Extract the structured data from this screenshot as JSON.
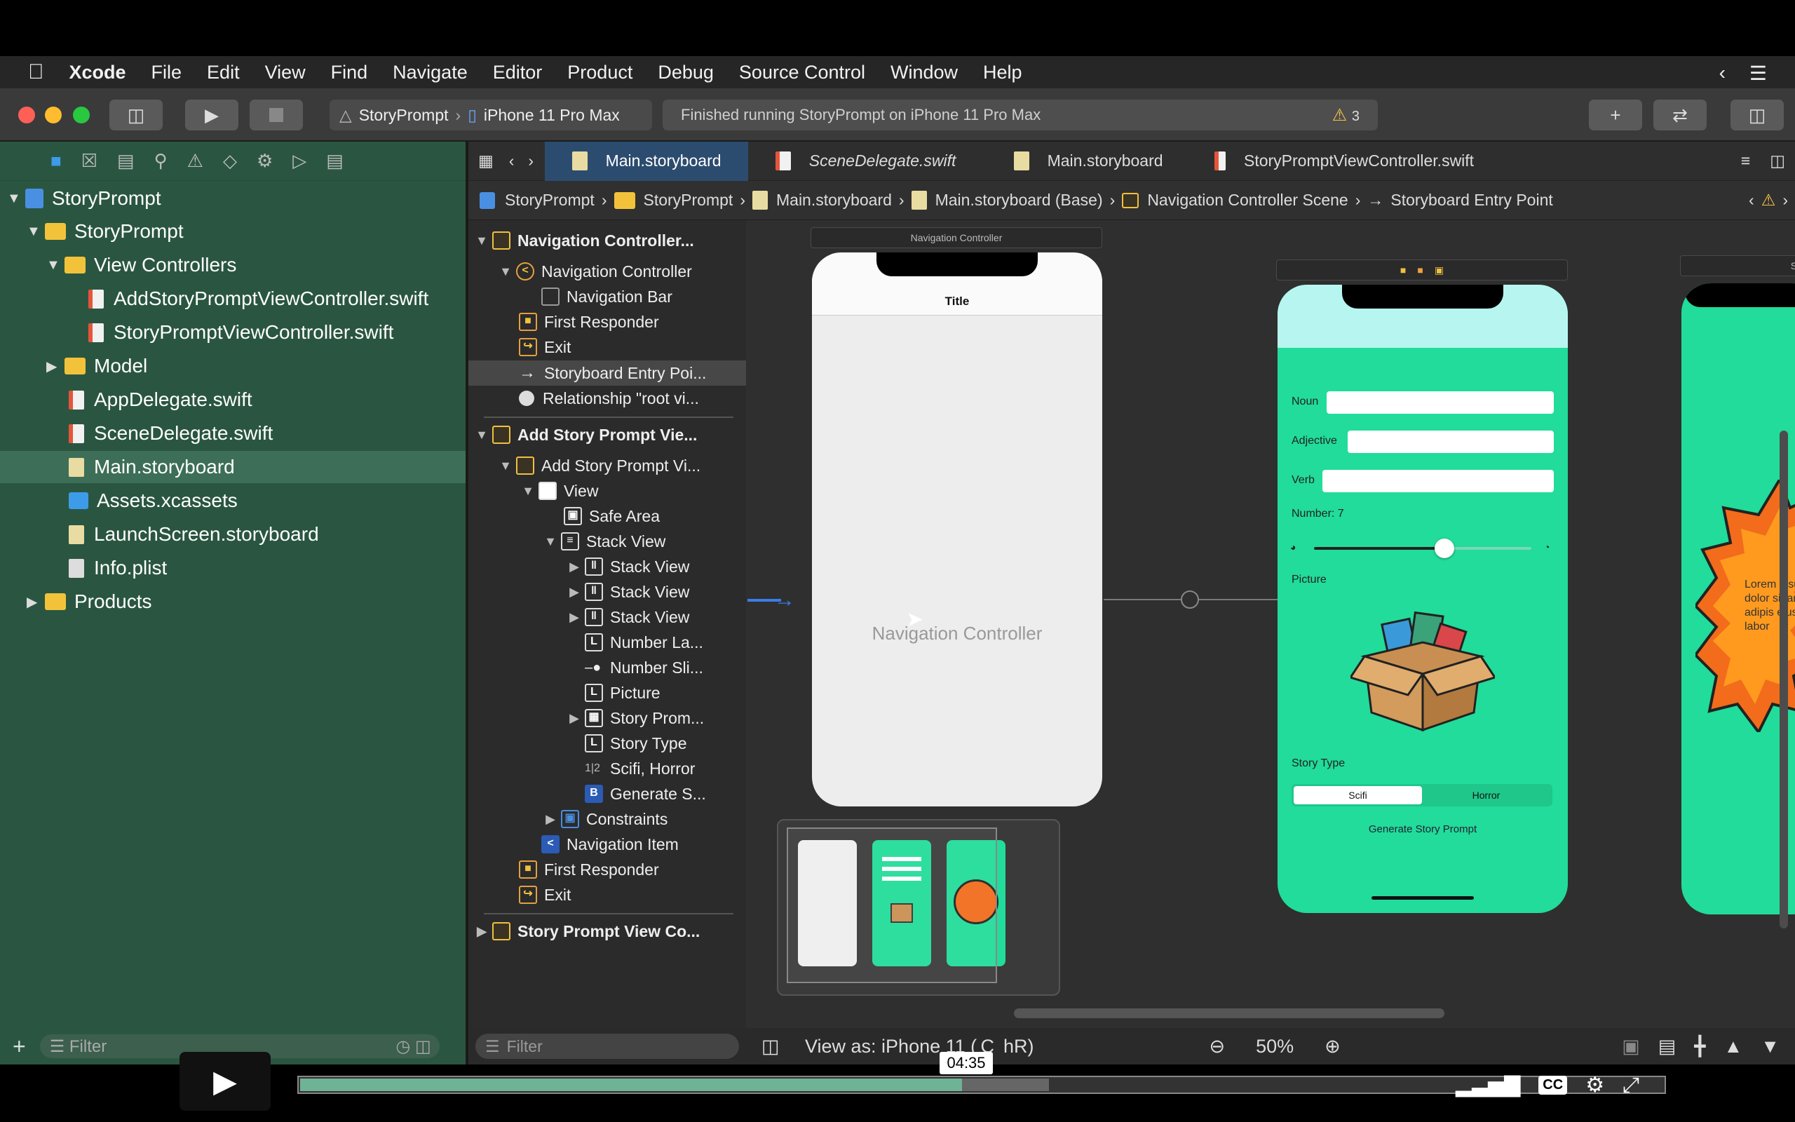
{
  "menubar": {
    "apple": "",
    "app": "Xcode",
    "items": [
      "File",
      "Edit",
      "View",
      "Find",
      "Navigate",
      "Editor",
      "Product",
      "Debug",
      "Source Control",
      "Window",
      "Help"
    ]
  },
  "toolbar": {
    "scheme": "StoryPrompt",
    "device": "iPhone 11 Pro Max",
    "status": "Finished running StoryPrompt on iPhone 11 Pro Max",
    "warnings": "3"
  },
  "navigator": {
    "project": "StoryPrompt",
    "group": "StoryPrompt",
    "vc_group": "View Controllers",
    "files": {
      "add_vc": "AddStoryPromptViewController.swift",
      "story_vc": "StoryPromptViewController.swift",
      "model": "Model",
      "app_delegate": "AppDelegate.swift",
      "scene_delegate": "SceneDelegate.swift",
      "main_sb": "Main.storyboard",
      "assets": "Assets.xcassets",
      "launch": "LaunchScreen.storyboard",
      "info": "Info.plist",
      "products": "Products"
    },
    "filter_placeholder": "Filter"
  },
  "tabs": [
    {
      "label": "Main.storyboard",
      "active": true
    },
    {
      "label": "SceneDelegate.swift",
      "active": false
    },
    {
      "label": "Main.storyboard",
      "active": false
    },
    {
      "label": "StoryPromptViewController.swift",
      "active": false
    }
  ],
  "jumpbar": [
    "StoryPrompt",
    "StoryPrompt",
    "Main.storyboard",
    "Main.storyboard (Base)",
    "Navigation Controller Scene",
    "Storyboard Entry Point"
  ],
  "outline": {
    "nav_scene": "Navigation Controller...",
    "nav_controller": "Navigation Controller",
    "nav_bar": "Navigation Bar",
    "first_responder": "First Responder",
    "exit": "Exit",
    "entry_point": "Storyboard Entry Poi...",
    "relationship": "Relationship \"root vi...",
    "add_scene": "Add Story Prompt Vie...",
    "add_vc": "Add Story Prompt Vi...",
    "view": "View",
    "safe_area": "Safe Area",
    "stack_view": "Stack View",
    "stack1": "Stack View",
    "stack2": "Stack View",
    "stack3": "Stack View",
    "number_label": "Number La...",
    "number_slider": "Number Sli...",
    "picture": "Picture",
    "story_prompt_image": "Story Prom...",
    "story_type": "Story Type",
    "segment": "Scifi, Horror",
    "generate": "Generate S...",
    "constraints": "Constraints",
    "nav_item": "Navigation Item",
    "first_responder2": "First Responder",
    "exit2": "Exit",
    "story_scene": "Story Prompt View Co...",
    "filter_placeholder": "Filter"
  },
  "canvas": {
    "scene1_title": "Navigation Controller",
    "phone1_title": "Title",
    "phone1_center": "Navigation Controller",
    "phone2": {
      "noun": "Noun",
      "adjective": "Adjective",
      "verb": "Verb",
      "number": "Number: 7",
      "slider_value": 0.6,
      "picture": "Picture",
      "story_type": "Story Type",
      "seg_scifi": "Scifi",
      "seg_horror": "Horror",
      "generate": "Generate Story Prompt"
    },
    "scene3_title": "St",
    "phone3_text": "Lorem ipsum dolor sit amet, adipis eiusm labor"
  },
  "bottombar": {
    "view_as": "View as: iPhone 11 ( C  hR)",
    "zoom": "50%"
  },
  "video": {
    "time": "04:35",
    "progress": 0.4857
  }
}
